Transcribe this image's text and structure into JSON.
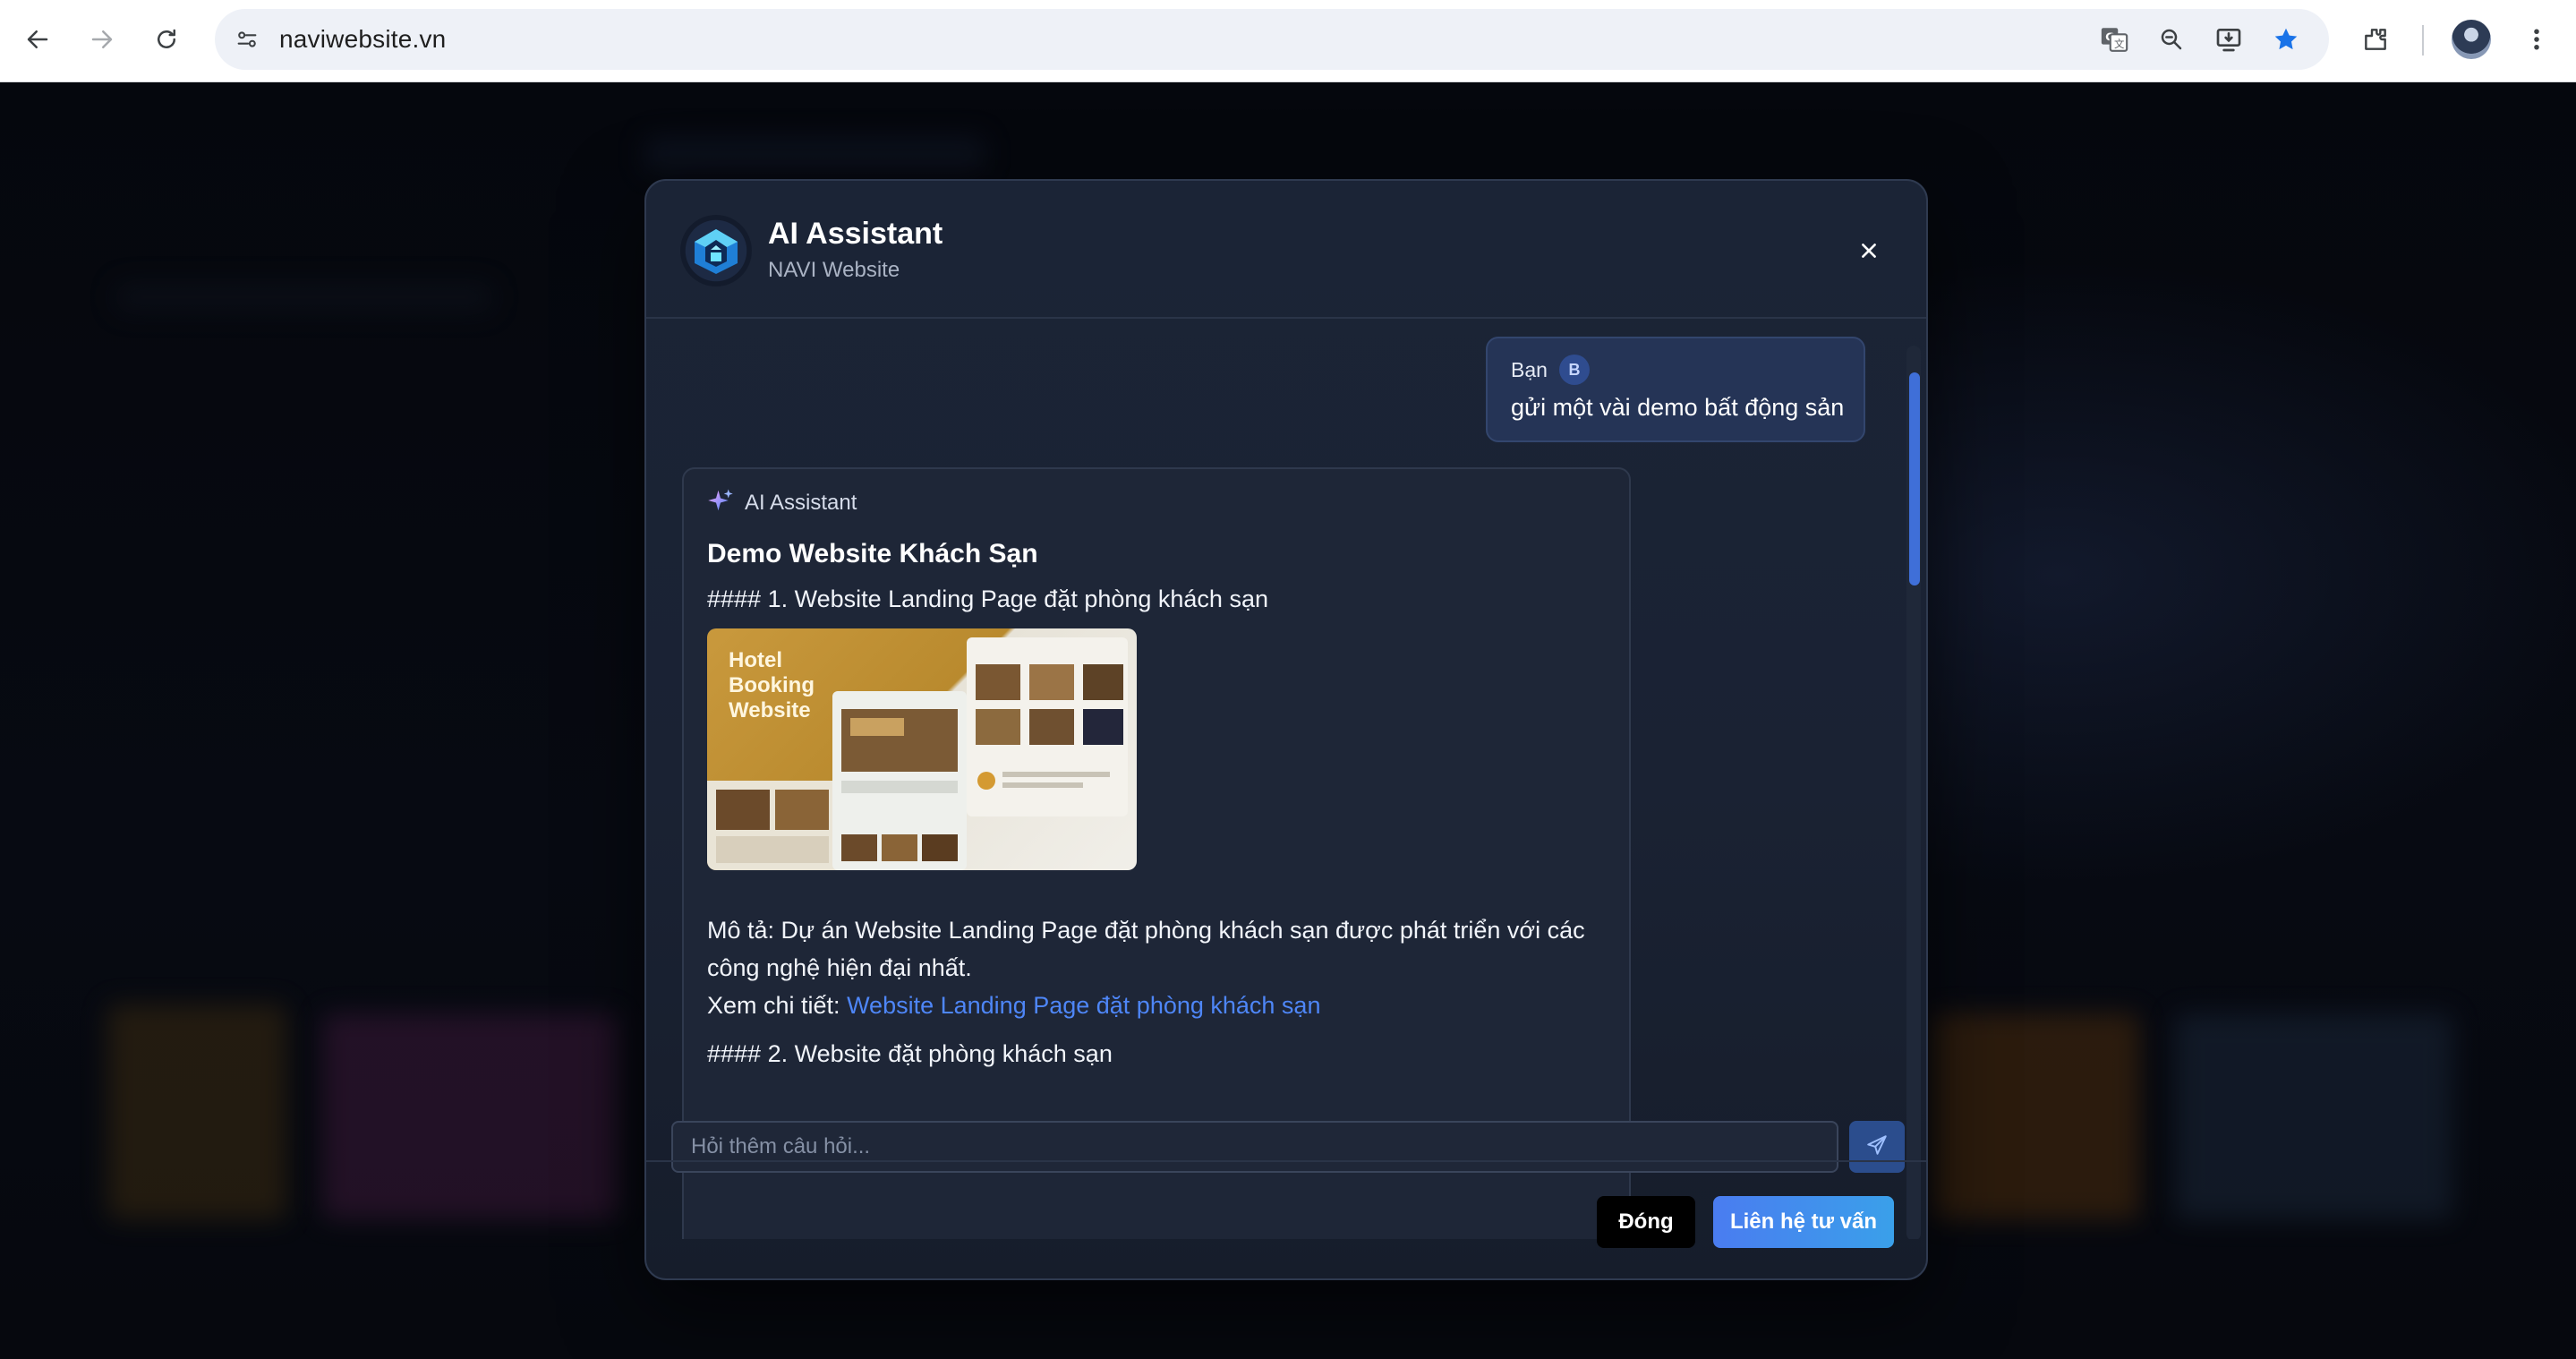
{
  "browser": {
    "url": "naviwebsite.vn",
    "icons": [
      "back-arrow-icon",
      "forward-arrow-icon",
      "reload-icon",
      "site-info-icon",
      "translate-icon",
      "zoom-icon",
      "install-app-icon",
      "bookmark-star-icon",
      "extensions-icon",
      "profile-avatar",
      "more-menu-icon"
    ],
    "accent_color": "#1a73e8"
  },
  "modal": {
    "title": "AI Assistant",
    "subtitle": "NAVI Website",
    "close_icon": "close-icon",
    "user_message": {
      "sender": "Bạn",
      "badge": "B",
      "text": "gửi một vài demo bất động sản"
    },
    "ai_message": {
      "sender": "AI Assistant",
      "sender_icon": "sparkle-icon",
      "heading": "Demo Website Khách Sạn",
      "item1_heading": "#### 1. Website Landing Page đặt phòng khách sạn",
      "image_caption": "Hotel Booking Website",
      "description_line1": "Mô tả: Dự án Website Landing Page đặt phòng khách sạn được phát triển với các",
      "description_line2": "công nghệ hiện đại nhất.",
      "detail_label": "Xem chi tiết: ",
      "detail_link": "Website Landing Page đặt phòng khách sạn",
      "item2_heading": "#### 2. Website đặt phòng khách sạn"
    },
    "input": {
      "placeholder": "Hỏi thêm câu hỏi...",
      "value": ""
    },
    "send_icon": "send-icon",
    "footer": {
      "close_label": "Đóng",
      "contact_label": "Liên hệ tư vấn"
    },
    "colors": {
      "link": "#4e86f7",
      "primary_button": "#4a7cf0",
      "scrollbar": "#3f6fd8"
    }
  }
}
